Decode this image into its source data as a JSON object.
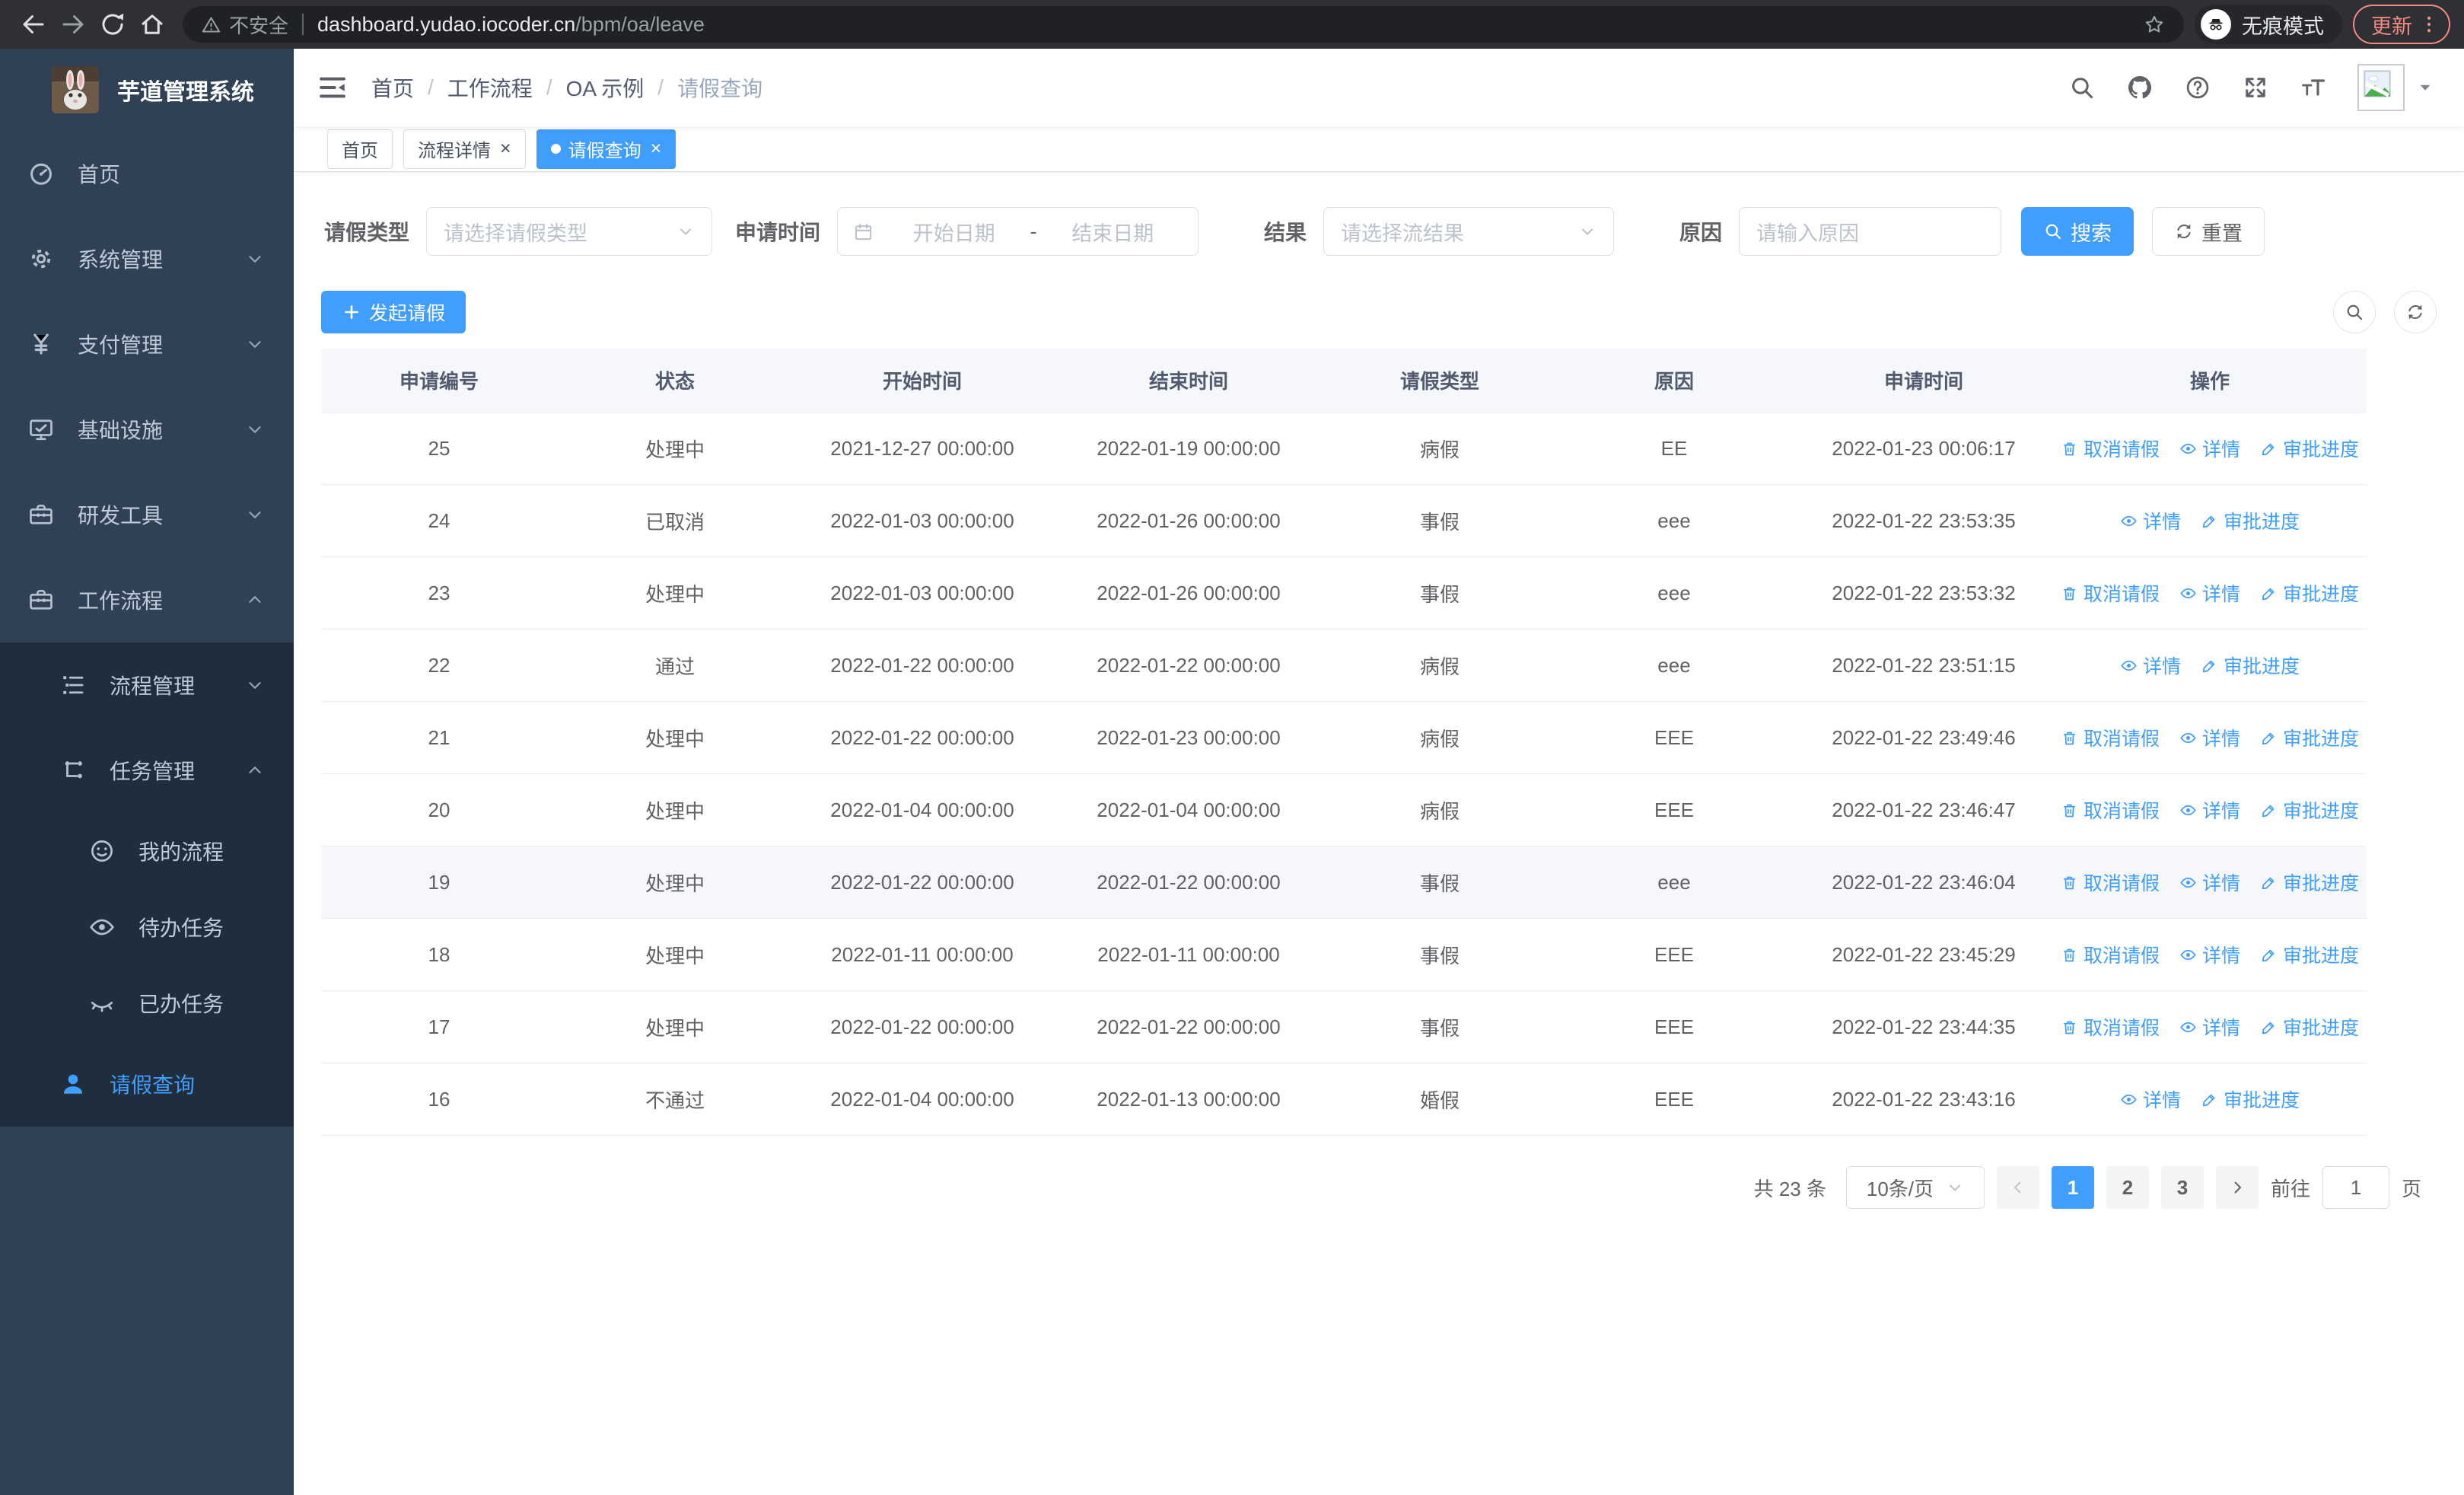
{
  "browser": {
    "security_label": "不安全",
    "url_host": "dashboard.yudao.iocoder.cn",
    "url_path": "/bpm/oa/leave",
    "incognito_label": "无痕模式",
    "update_label": "更新"
  },
  "app": {
    "title": "芋道管理系统"
  },
  "sidebar": {
    "menu": [
      {
        "key": "home",
        "label": "首页",
        "icon": "dashboard-icon",
        "level": 1,
        "sub": false,
        "active": false,
        "arrow": null
      },
      {
        "key": "system-management",
        "label": "系统管理",
        "icon": "gear-icon",
        "level": 1,
        "sub": false,
        "active": false,
        "arrow": "down"
      },
      {
        "key": "payment-management",
        "label": "支付管理",
        "icon": "yen-icon",
        "level": 1,
        "sub": false,
        "active": false,
        "arrow": "down"
      },
      {
        "key": "infrastructure",
        "label": "基础设施",
        "icon": "monitor-icon",
        "level": 1,
        "sub": false,
        "active": false,
        "arrow": "down"
      },
      {
        "key": "dev-tools",
        "label": "研发工具",
        "icon": "toolbox-icon",
        "level": 1,
        "sub": false,
        "active": false,
        "arrow": "down"
      },
      {
        "key": "workflow",
        "label": "工作流程",
        "icon": "toolbox-icon",
        "level": 1,
        "sub": false,
        "active": false,
        "arrow": "up"
      },
      {
        "key": "process-management",
        "label": "流程管理",
        "icon": "tree-icon",
        "level": 2,
        "sub": true,
        "active": false,
        "arrow": "down"
      },
      {
        "key": "task-management",
        "label": "任务管理",
        "icon": "flow-icon",
        "level": 2,
        "sub": true,
        "active": false,
        "arrow": "up"
      },
      {
        "key": "my-process",
        "label": "我的流程",
        "icon": "face-icon",
        "level": 3,
        "sub": true,
        "active": false,
        "arrow": null
      },
      {
        "key": "todo-tasks",
        "label": "待办任务",
        "icon": "eye-icon",
        "level": 3,
        "sub": true,
        "active": false,
        "arrow": null
      },
      {
        "key": "done-tasks",
        "label": "已办任务",
        "icon": "eye-closed-icon",
        "level": 3,
        "sub": true,
        "active": false,
        "arrow": null
      },
      {
        "key": "leave-query",
        "label": "请假查询",
        "icon": "user-icon",
        "level": 2,
        "sub": true,
        "active": true,
        "arrow": null
      }
    ]
  },
  "breadcrumb": {
    "separator": "/",
    "items": [
      "首页",
      "工作流程",
      "OA 示例",
      "请假查询"
    ]
  },
  "tabs": [
    {
      "label": "首页",
      "active": false,
      "closable": false
    },
    {
      "label": "流程详情",
      "active": false,
      "closable": true
    },
    {
      "label": "请假查询",
      "active": true,
      "closable": true
    }
  ],
  "filters": {
    "leave_type_label": "请假类型",
    "leave_type_placeholder": "请选择请假类型",
    "apply_time_label": "申请时间",
    "date_start_placeholder": "开始日期",
    "date_separator": "-",
    "date_end_placeholder": "结束日期",
    "result_label": "结果",
    "result_placeholder": "请选择流结果",
    "reason_label": "原因",
    "reason_placeholder": "请输入原因",
    "search_label": "搜索",
    "reset_label": "重置"
  },
  "toolbar": {
    "create_label": "发起请假"
  },
  "table": {
    "columns": [
      "申请编号",
      "状态",
      "开始时间",
      "结束时间",
      "请假类型",
      "原因",
      "申请时间",
      "操作"
    ],
    "action_labels": {
      "cancel": "取消请假",
      "detail": "详情",
      "progress": "审批进度"
    },
    "rows": [
      {
        "no": "25",
        "status": "处理中",
        "start": "2021-12-27 00:00:00",
        "end": "2022-01-19 00:00:00",
        "type": "病假",
        "reason": "EE",
        "applied": "2022-01-23 00:06:17",
        "actions": [
          "cancel",
          "detail",
          "progress"
        ],
        "highlight": false
      },
      {
        "no": "24",
        "status": "已取消",
        "start": "2022-01-03 00:00:00",
        "end": "2022-01-26 00:00:00",
        "type": "事假",
        "reason": "eee",
        "applied": "2022-01-22 23:53:35",
        "actions": [
          "detail",
          "progress"
        ],
        "highlight": false
      },
      {
        "no": "23",
        "status": "处理中",
        "start": "2022-01-03 00:00:00",
        "end": "2022-01-26 00:00:00",
        "type": "事假",
        "reason": "eee",
        "applied": "2022-01-22 23:53:32",
        "actions": [
          "cancel",
          "detail",
          "progress"
        ],
        "highlight": false
      },
      {
        "no": "22",
        "status": "通过",
        "start": "2022-01-22 00:00:00",
        "end": "2022-01-22 00:00:00",
        "type": "病假",
        "reason": "eee",
        "applied": "2022-01-22 23:51:15",
        "actions": [
          "detail",
          "progress"
        ],
        "highlight": false
      },
      {
        "no": "21",
        "status": "处理中",
        "start": "2022-01-22 00:00:00",
        "end": "2022-01-23 00:00:00",
        "type": "病假",
        "reason": "EEE",
        "applied": "2022-01-22 23:49:46",
        "actions": [
          "cancel",
          "detail",
          "progress"
        ],
        "highlight": false
      },
      {
        "no": "20",
        "status": "处理中",
        "start": "2022-01-04 00:00:00",
        "end": "2022-01-04 00:00:00",
        "type": "病假",
        "reason": "EEE",
        "applied": "2022-01-22 23:46:47",
        "actions": [
          "cancel",
          "detail",
          "progress"
        ],
        "highlight": false
      },
      {
        "no": "19",
        "status": "处理中",
        "start": "2022-01-22 00:00:00",
        "end": "2022-01-22 00:00:00",
        "type": "事假",
        "reason": "eee",
        "applied": "2022-01-22 23:46:04",
        "actions": [
          "cancel",
          "detail",
          "progress"
        ],
        "highlight": true
      },
      {
        "no": "18",
        "status": "处理中",
        "start": "2022-01-11 00:00:00",
        "end": "2022-01-11 00:00:00",
        "type": "事假",
        "reason": "EEE",
        "applied": "2022-01-22 23:45:29",
        "actions": [
          "cancel",
          "detail",
          "progress"
        ],
        "highlight": false
      },
      {
        "no": "17",
        "status": "处理中",
        "start": "2022-01-22 00:00:00",
        "end": "2022-01-22 00:00:00",
        "type": "事假",
        "reason": "EEE",
        "applied": "2022-01-22 23:44:35",
        "actions": [
          "cancel",
          "detail",
          "progress"
        ],
        "highlight": false
      },
      {
        "no": "16",
        "status": "不通过",
        "start": "2022-01-04 00:00:00",
        "end": "2022-01-13 00:00:00",
        "type": "婚假",
        "reason": "EEE",
        "applied": "2022-01-22 23:43:16",
        "actions": [
          "detail",
          "progress"
        ],
        "highlight": false
      }
    ]
  },
  "pagination": {
    "total_label": "共 23 条",
    "page_size_label": "10条/页",
    "pages": [
      "1",
      "2",
      "3"
    ],
    "current": "1",
    "goto_label": "前往",
    "goto_value": "1",
    "unit_label": "页"
  },
  "colors": {
    "primary": "#409EFF",
    "sidebar_bg": "#304156",
    "submenu_bg": "#1f2d3d",
    "update_accent": "#f28b82"
  }
}
